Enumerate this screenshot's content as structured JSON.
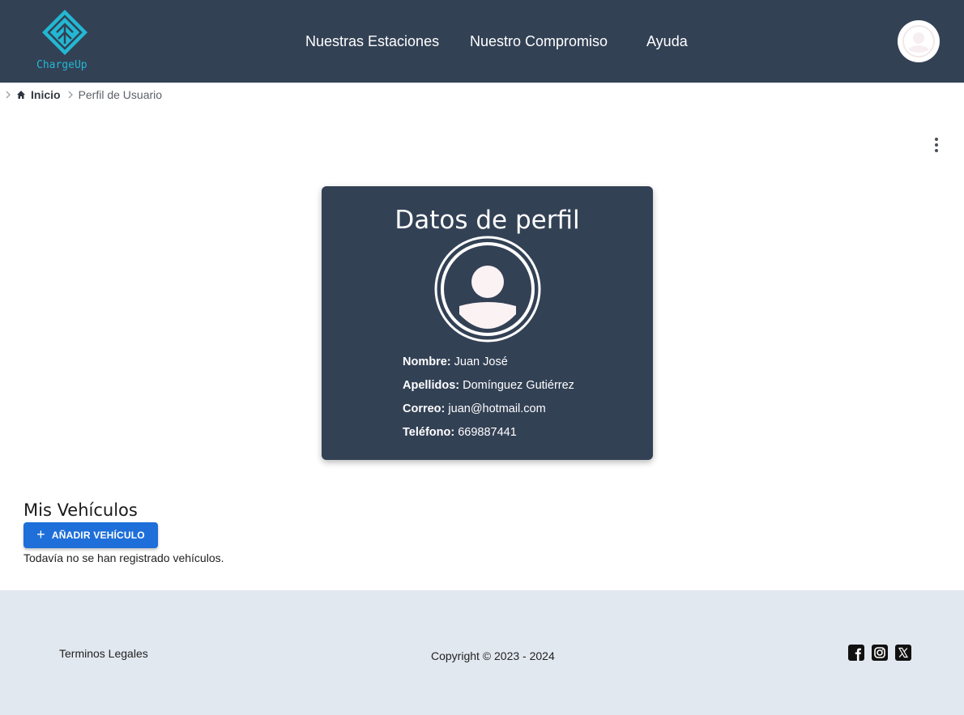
{
  "header": {
    "logo_text": "ChargeUp",
    "nav": [
      {
        "label": "Nuestras Estaciones"
      },
      {
        "label": "Nuestro Compromiso"
      },
      {
        "label": "Ayuda"
      }
    ],
    "avatar_icon": "user-avatar-icon"
  },
  "breadcrumb": {
    "home_label": "Inicio",
    "current_label": "Perfil de Usuario"
  },
  "profile": {
    "title": "Datos de perfil",
    "fields": [
      {
        "key": "Nombre:",
        "value": "Juan José"
      },
      {
        "key": "Apellidos:",
        "value": "Domínguez Gutiérrez"
      },
      {
        "key": "Correo:",
        "value": "juan@hotmail.com"
      },
      {
        "key": "Teléfono:",
        "value": "669887441"
      }
    ]
  },
  "vehicles": {
    "title": "Mis Vehículos",
    "add_label": "AÑADIR VEHÍCULO",
    "empty_text": "Todavía no se han registrado vehículos."
  },
  "footer": {
    "terms_label": "Terminos Legales",
    "copyright": "Copyright © 2023 - 2024",
    "social": [
      "facebook-icon",
      "instagram-icon",
      "x-icon"
    ]
  },
  "colors": {
    "header_bg": "#334155",
    "card_bg": "#334155",
    "footer_bg": "#e2e8f0",
    "primary_button": "#1e6fd9",
    "logo_accent": "#22b8d3"
  }
}
